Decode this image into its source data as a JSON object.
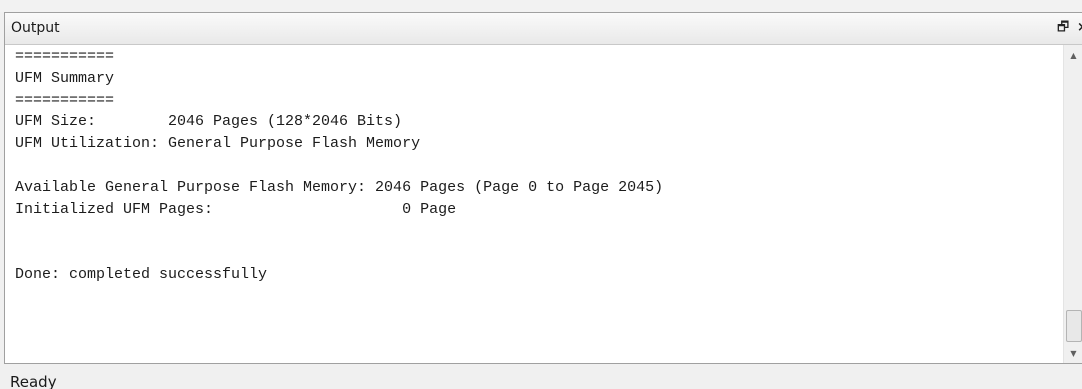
{
  "panel": {
    "title": "Output",
    "restore_glyph": "🗗",
    "close_glyph": "×"
  },
  "console": {
    "lines": [
      "===========",
      "UFM Summary",
      "===========",
      "UFM Size:        2046 Pages (128*2046 Bits)",
      "UFM Utilization: General Purpose Flash Memory",
      "",
      "Available General Purpose Flash Memory: 2046 Pages (Page 0 to Page 2045)",
      "Initialized UFM Pages:                     0 Page",
      "",
      "",
      "Done: completed successfully"
    ]
  },
  "scrollbar": {
    "up_glyph": "▲",
    "down_glyph": "▼"
  },
  "status": {
    "text": "Ready"
  },
  "icons": {
    "restore": "restore-window-icon",
    "close": "close-icon",
    "scroll_up": "scroll-up-arrow-icon",
    "scroll_down": "scroll-down-arrow-icon"
  }
}
